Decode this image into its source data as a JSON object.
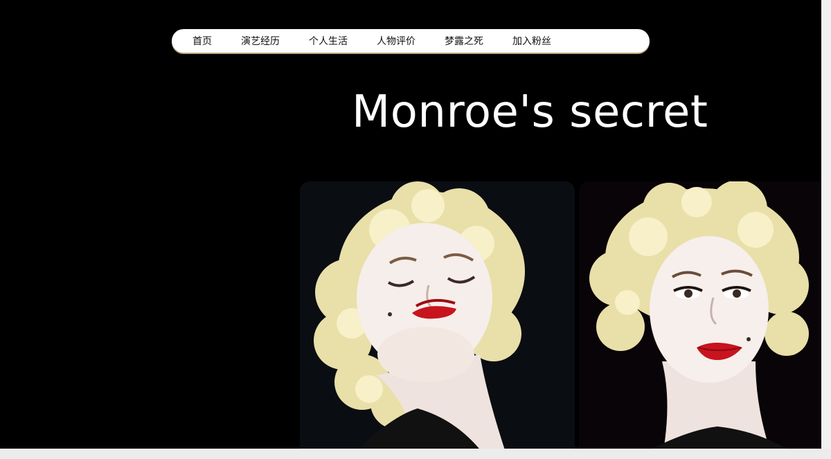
{
  "nav": {
    "items": [
      {
        "label": "首页"
      },
      {
        "label": "演艺经历"
      },
      {
        "label": "个人生活"
      },
      {
        "label": "人物评价"
      },
      {
        "label": "梦露之死"
      },
      {
        "label": "加入粉丝"
      }
    ]
  },
  "hero": {
    "title": "Monroe's secret"
  },
  "gallery": {
    "images": [
      {
        "icon": "portrait-eyes-closed-photo"
      },
      {
        "icon": "portrait-eyes-open-photo"
      }
    ]
  },
  "colors": {
    "page_background": "#000000",
    "nav_background": "#ffffff",
    "nav_shadow": "#b7a978",
    "title_color": "#ffffff",
    "hair": "#efe6b4",
    "lips": "#c8141e",
    "skin": "#f5ece8"
  }
}
